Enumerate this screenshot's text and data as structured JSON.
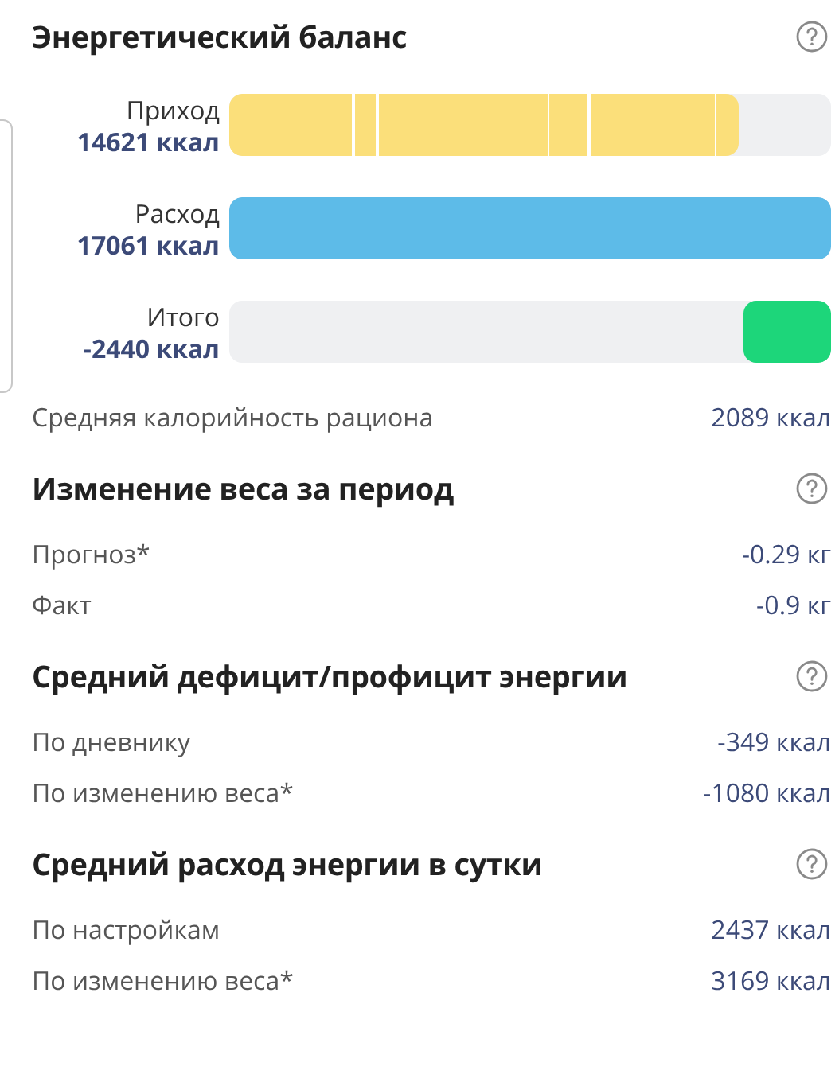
{
  "balance": {
    "title": "Энергетический баланс",
    "bars": [
      {
        "kind": "segmented",
        "label": "Приход",
        "value": "14621 ккал",
        "color": "#fbdf7a",
        "level": 0.846
      },
      {
        "kind": "solid",
        "label": "Расход",
        "value": "17061 ккал",
        "color": "#5dbbe8",
        "level": 1
      },
      {
        "kind": "end",
        "label": "Итого",
        "value": "-2440 ккал",
        "color": "#1dd67a",
        "level": 0.145
      }
    ],
    "average": {
      "label": "Средняя калорийность рациона",
      "value": "2089 ккал"
    }
  },
  "sections": [
    {
      "title": "Изменение веса за период",
      "rows": [
        {
          "label": "Прогноз*",
          "value": "-0.29 кг"
        },
        {
          "label": "Факт",
          "value": "-0.9 кг"
        }
      ]
    },
    {
      "title": "Средний дефицит/профицит энергии",
      "rows": [
        {
          "label": "По дневнику",
          "value": "-349 ккал"
        },
        {
          "label": "По изменению веса*",
          "value": "-1080 ккал"
        }
      ]
    },
    {
      "title": "Средний расход энергии в сутки",
      "rows": [
        {
          "label": "По настройкам",
          "value": "2437 ккал"
        },
        {
          "label": "По изменению веса*",
          "value": "3169 ккал"
        }
      ]
    }
  ]
}
